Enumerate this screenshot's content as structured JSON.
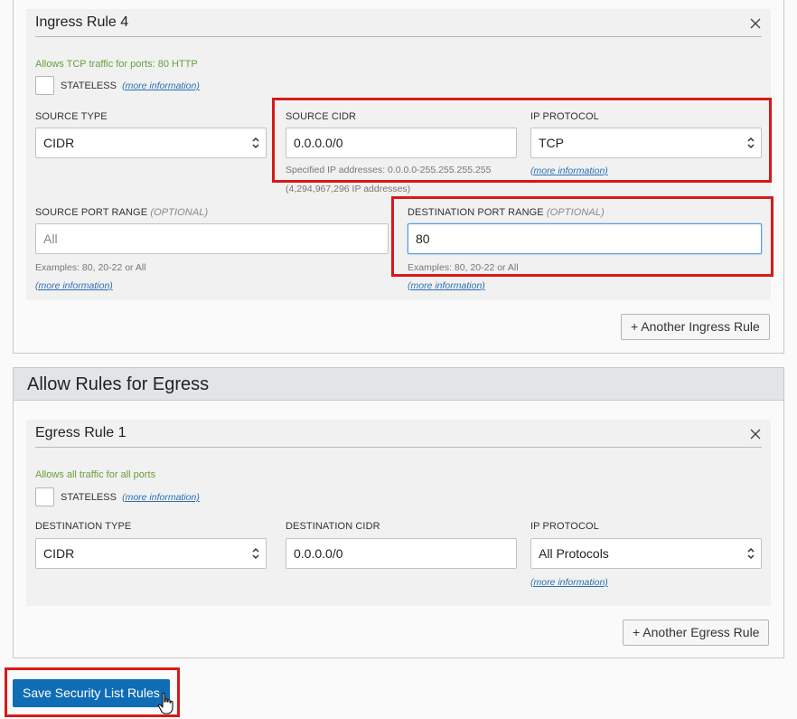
{
  "ingress_rule": {
    "title": "Ingress Rule 4",
    "description": "Allows TCP traffic for ports: 80 HTTP",
    "stateless_label": "STATELESS",
    "more_info": "(more information)",
    "source_type": {
      "label": "SOURCE TYPE",
      "value": "CIDR"
    },
    "source_cidr": {
      "label": "SOURCE CIDR",
      "value": "0.0.0.0/0",
      "help_1": "Specified IP addresses: 0.0.0.0-255.255.255.255",
      "help_2": "(4,294,967,296 IP addresses)"
    },
    "ip_protocol": {
      "label": "IP PROTOCOL",
      "value": "TCP",
      "more_info": "(more information)"
    },
    "source_port_range": {
      "label": "SOURCE PORT RANGE",
      "optional": "(OPTIONAL)",
      "placeholder": "All",
      "help": "Examples: 80, 20-22 or All",
      "more_info": "(more information)"
    },
    "destination_port_range": {
      "label": "DESTINATION PORT RANGE",
      "optional": "(OPTIONAL)",
      "value": "80",
      "help": "Examples: 80, 20-22 or All",
      "more_info": "(more information)"
    },
    "add_button": "+ Another Ingress Rule"
  },
  "egress_section": {
    "title": "Allow Rules for Egress",
    "rule": {
      "title": "Egress Rule 1",
      "description": "Allows all traffic for all ports",
      "stateless_label": "STATELESS",
      "more_info": "(more information)",
      "destination_type": {
        "label": "DESTINATION TYPE",
        "value": "CIDR"
      },
      "destination_cidr": {
        "label": "DESTINATION CIDR",
        "value": "0.0.0.0/0"
      },
      "ip_protocol": {
        "label": "IP PROTOCOL",
        "value": "All Protocols",
        "more_info": "(more information)"
      }
    },
    "add_button": "+ Another Egress Rule"
  },
  "save_button": "Save Security List Rules",
  "colors": {
    "primary": "#0f6db5",
    "highlight": "#d71a1a",
    "description": "#6a9f3a",
    "link": "#2b6fb3"
  }
}
